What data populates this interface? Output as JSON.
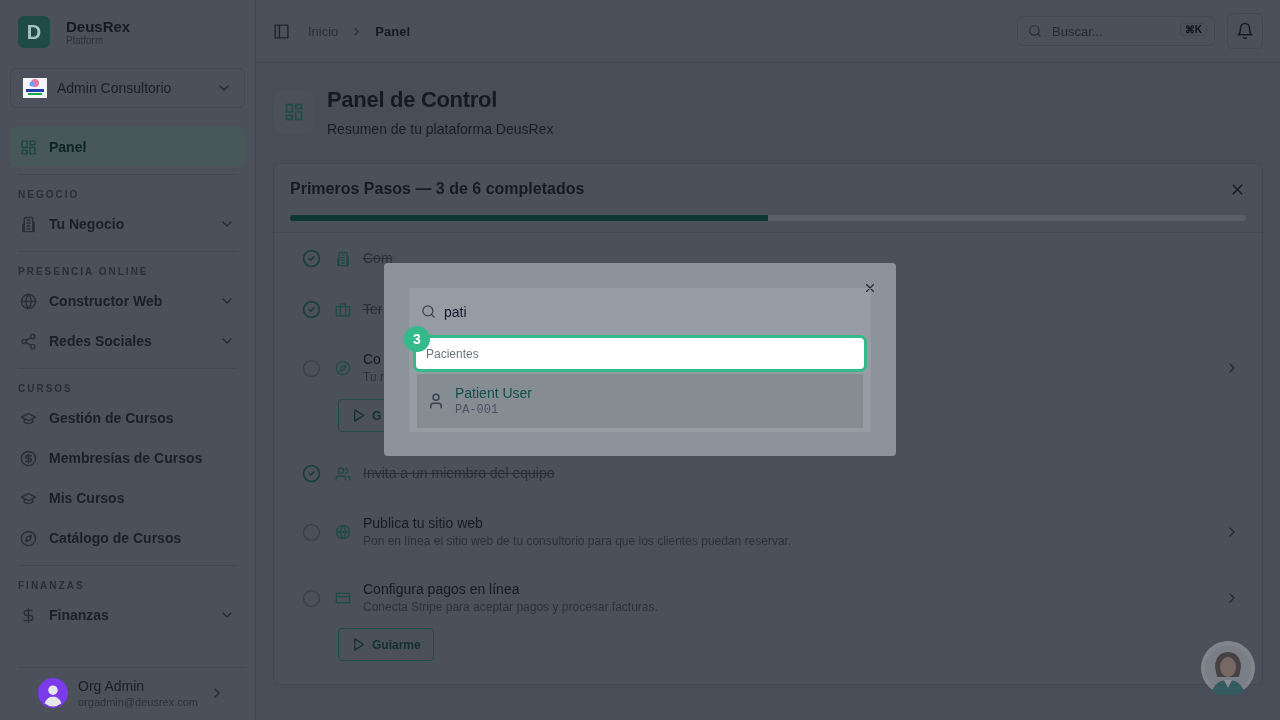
{
  "sidebar": {
    "brand": {
      "letter": "D",
      "name": "DeusRex",
      "subtitle": "Platform"
    },
    "org": {
      "name": "Admin Consultorio"
    },
    "sections": [
      {
        "items": [
          {
            "label": "Panel",
            "selected": true,
            "expandable": false
          }
        ]
      },
      {
        "title": "NEGOCIO",
        "items": [
          {
            "label": "Tu Negocio",
            "selected": false,
            "expandable": true
          }
        ]
      },
      {
        "title": "PRESENCIA ONLINE",
        "items": [
          {
            "label": "Constructor Web",
            "selected": false,
            "expandable": true
          },
          {
            "label": "Redes Sociales",
            "selected": false,
            "expandable": true
          }
        ]
      },
      {
        "title": "CURSOS",
        "items": [
          {
            "label": "Gestión de Cursos",
            "selected": false,
            "expandable": false
          },
          {
            "label": "Membresías de Cursos",
            "selected": false,
            "expandable": false
          },
          {
            "label": "Mis Cursos",
            "selected": false,
            "expandable": false
          },
          {
            "label": "Catálogo de Cursos",
            "selected": false,
            "expandable": false
          }
        ]
      },
      {
        "title": "FINANZAS",
        "items": [
          {
            "label": "Finanzas",
            "selected": false,
            "expandable": true
          }
        ]
      }
    ],
    "user": {
      "name": "Org Admin",
      "email": "orgadmin@deusrex.com"
    }
  },
  "header": {
    "breadcrumb": [
      "Inicio",
      "Panel"
    ],
    "search": {
      "placeholder": "Buscar...",
      "shortcut": "⌘K"
    }
  },
  "page": {
    "title": "Panel de Control",
    "subtitle": "Resumen de tu plataforma DeusRex"
  },
  "checklist": {
    "title": "Primeros Pasos — 3 de 6 completados",
    "level": 0.5,
    "steps": [
      {
        "done": true,
        "title": "Com",
        "chevron": false
      },
      {
        "done": true,
        "title": "Ter",
        "chevron": false
      },
      {
        "done": false,
        "title": "Co",
        "description": "Tu r",
        "button": "G",
        "chevron": true
      },
      {
        "done": true,
        "title": "Invita a un miembro del equipo",
        "chevron": false
      },
      {
        "done": false,
        "title": "Publica tu sitio web",
        "description": "Pon en línea el sitio web de tu consultorio para que los clientes puedan reservar.",
        "chevron": true
      },
      {
        "done": false,
        "title": "Configura pagos en línea",
        "description": "Conecta Stripe para aceptar pagos y procesar facturas.",
        "button": "Guiarme",
        "chevron": true
      }
    ]
  },
  "tour": {
    "step": "3",
    "search_value": "pati",
    "group_label": "Pacientes",
    "results": [
      {
        "name": "Patient User",
        "code": "PA-001"
      }
    ]
  }
}
